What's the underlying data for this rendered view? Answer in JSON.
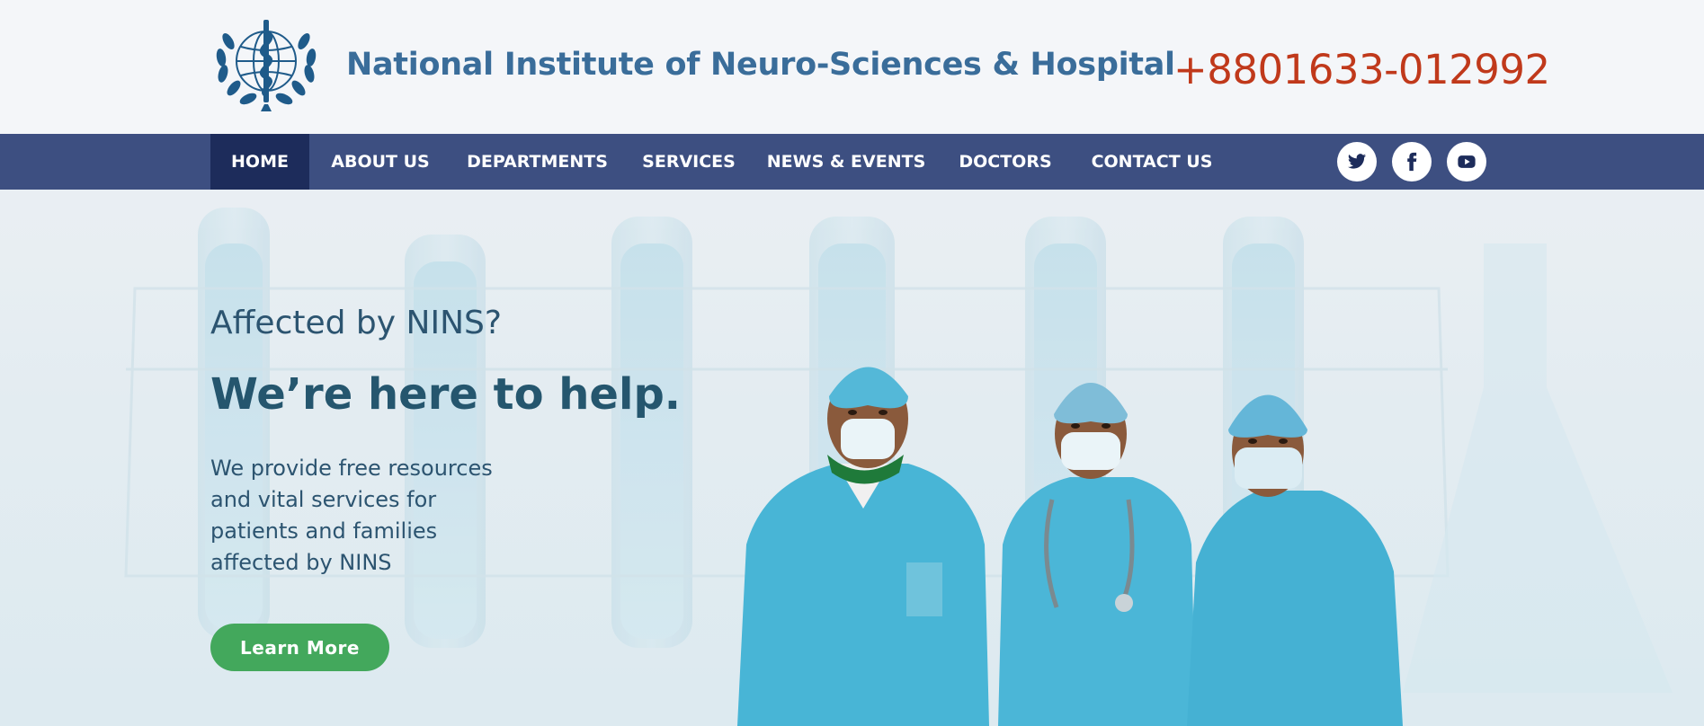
{
  "header": {
    "logo_icon": "who-emblem-icon",
    "title": "National Institute of Neuro-Sciences & Hospital",
    "phone": "+8801633-012992"
  },
  "nav": {
    "items": [
      {
        "label": "HOME",
        "active": true
      },
      {
        "label": "ABOUT US"
      },
      {
        "label": "DEPARTMENTS"
      },
      {
        "label": "SERVICES"
      },
      {
        "label": "NEWS & EVENTS"
      },
      {
        "label": "DOCTORS"
      },
      {
        "label": "CONTACT US"
      }
    ],
    "social": [
      "twitter-icon",
      "facebook-icon",
      "youtube-icon"
    ]
  },
  "hero": {
    "eyebrow": "Affected by NINS?",
    "headline": "We’re here to help.",
    "body": "We provide free resources and vital services for patients and families affected by NINS",
    "button": "Learn More",
    "image": "three-doctors-in-blue-scrubs-photo"
  },
  "colors": {
    "nav_bg": "#3d4f81",
    "nav_active": "#1d2c5b",
    "title": "#3a6d9a",
    "phone": "#c0391b",
    "button": "#43a85c"
  }
}
